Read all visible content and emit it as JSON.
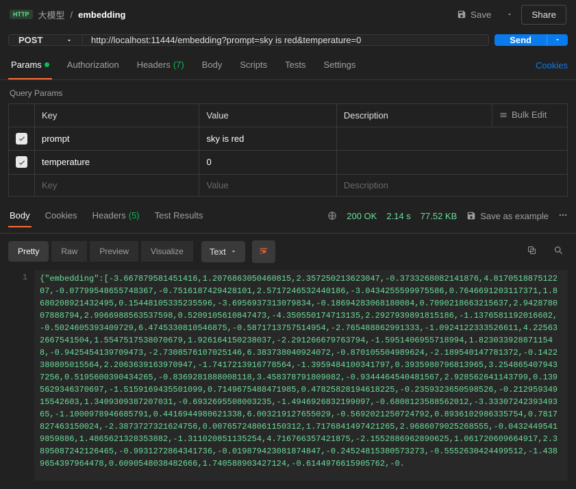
{
  "breadcrumb": {
    "method_badge": "HTTP",
    "folder": "大模型",
    "current": "embedding",
    "save_label": "Save",
    "share_label": "Share"
  },
  "request": {
    "method": "POST",
    "url": "http://localhost:11444/embedding?prompt=sky is red&temperature=0",
    "send_label": "Send"
  },
  "tabs": {
    "params": "Params",
    "authorization": "Authorization",
    "headers": "Headers",
    "headers_count": "(7)",
    "body": "Body",
    "scripts": "Scripts",
    "tests": "Tests",
    "settings": "Settings",
    "cookies": "Cookies"
  },
  "query": {
    "title": "Query Params",
    "columns": {
      "key": "Key",
      "value": "Value",
      "desc": "Description"
    },
    "bulk_edit": "Bulk Edit",
    "rows": [
      {
        "key": "prompt",
        "value": "sky is red",
        "desc": ""
      },
      {
        "key": "temperature",
        "value": "0",
        "desc": ""
      }
    ],
    "placeholder": {
      "key": "Key",
      "value": "Value",
      "desc": "Description"
    }
  },
  "response": {
    "tabs": {
      "body": "Body",
      "cookies": "Cookies",
      "headers": "Headers",
      "headers_count": "(5)",
      "test_results": "Test Results"
    },
    "status": "200 OK",
    "time": "2.14 s",
    "size": "77.52 KB",
    "save_example": "Save as example",
    "view": {
      "pretty": "Pretty",
      "raw": "Raw",
      "preview": "Preview",
      "visualize": "Visualize",
      "type": "Text"
    },
    "line_number": "1",
    "body_text": "{\"embedding\":[-3.667879581451416,1.2076863050460815,2.357250213623047,-0.3733268082141876,4.817051887512207,-0.07799548655748367,-0.7516187429428101,2.5717246532440186,-3.0434255599975586,0.7646691203117371,1.8680208921432495,0.15448105335235596,-3.6956937313079834,-0.18694283068180084,0.7090218663215637,2.942878007888794,2.9966988563537598,0.5209105610847473,-4.350550174713135,2.2927939891815186,-1.1376581192016602,-0.5024605393409729,6.4745330810546875,-0.5871713757514954,-2.765488862991333,-1.0924122333526611,4.225632667541504,1.5547517538070679,1.926164150238037,-2.291266679763794,-1.5951406955718994,1.8230339288711548,-0.9425454139709473,-2.7308576107025146,6.383738040924072,-0.870105504989624,-2.189540147781372,-0.1422380805015564,2.2063639163970947,-1.7417213916778564,-1.3959484100341797,0.3935980796813965,3.2548654079437256,0.5195600390434265,-0.8369281888008118,3.458378791809082,-0.9344464540481567,2.928562641143799,0.1395629346370697,-1.5159169435501099,0.7149675488471985,0.47825828194618225,-0.2359323650598526,-0.21295934915542603,1.3409309387207031,-0.6932695508003235,-1.4946926832199097,-0.6808123588562012,-3.3330724239349365,-1.1000978946685791,0.4416944980621338,6.003219127655029,-0.5692021250724792,0.8936102986335754,0.7817827463150024,-2.3873727321624756,0.007657248061150312,1.7176841497421265,2.9686079025268555,-0.04324495419859886,1.4865621328353882,-1.311020851135254,4.716766357421875,-2.1552886962890625,1.061720609664917,2.3895087242126465,-0.9931272864341736,-0.019879423081874847,-0.24524815380573273,-0.5552630424499512,-1.4389654397964478,0.6090548038482666,1.740588903427124,-0.6144976615905762,-0."
  }
}
